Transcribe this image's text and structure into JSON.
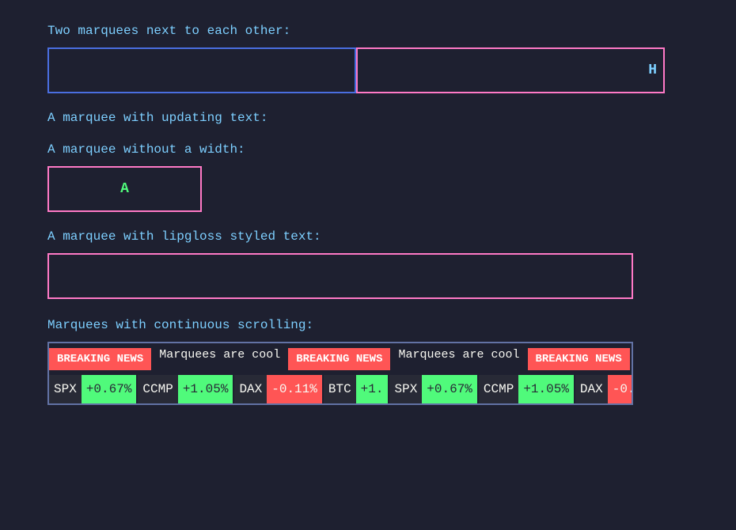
{
  "labels": {
    "two_marquees": "Two marquees next to each other:",
    "updating_text": "A marquee with updating text:",
    "without_width": "A marquee without a width:",
    "lipgloss": "A marquee with lipgloss styled text:",
    "continuous": "Marquees with continuous scrolling:"
  },
  "marquee_right_letter": "H",
  "marquee_small_letter": "A",
  "news": {
    "breaking": "BREAKING NEWS",
    "text": "Marquees are cool",
    "stocks": [
      {
        "name": "SPX",
        "value": "+0.67%",
        "positive": true
      },
      {
        "name": "CCMP",
        "value": "+1.05%",
        "positive": true
      },
      {
        "name": "DAX",
        "value": "-0.11%",
        "positive": false
      },
      {
        "name": "BTC",
        "value": "+1.",
        "positive": true
      }
    ]
  }
}
